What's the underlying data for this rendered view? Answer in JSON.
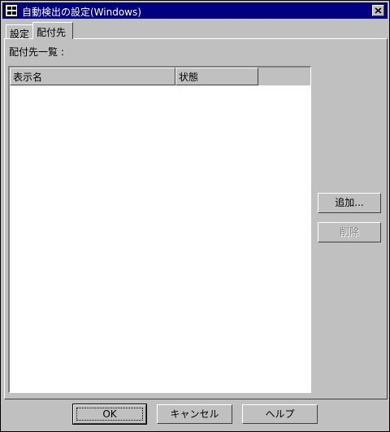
{
  "window": {
    "title": "自動検出の設定(Windows)"
  },
  "tabs": [
    {
      "label": "設定"
    },
    {
      "label": "配付先"
    }
  ],
  "panel": {
    "list_label": "配付先一覧 :",
    "columns": [
      {
        "label": "表示名"
      },
      {
        "label": "状態"
      }
    ],
    "rows": []
  },
  "side_buttons": {
    "add": "追加...",
    "delete": "削除"
  },
  "footer_buttons": {
    "ok": "OK",
    "cancel": "キャンセル",
    "help": "ヘルプ"
  },
  "colors": {
    "face": "#c0c0c0",
    "title_bar": "#000080",
    "disabled_text": "#808080"
  },
  "icons": {
    "app": "app-icon",
    "close": "close-icon"
  }
}
